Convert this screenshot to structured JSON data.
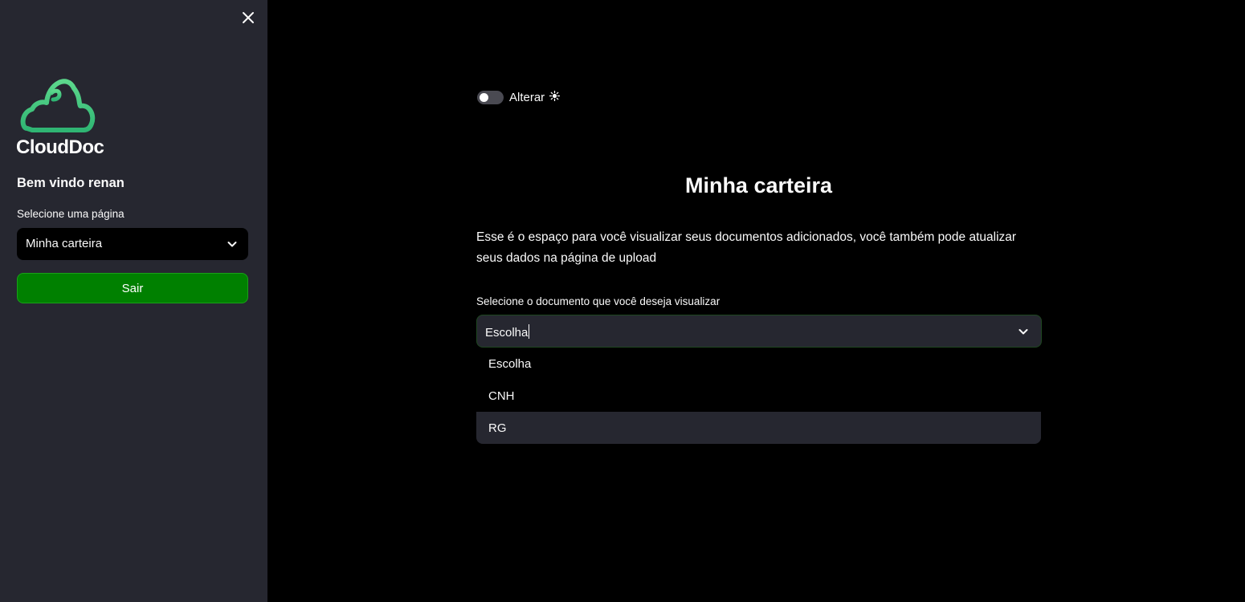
{
  "sidebar": {
    "logo_text": "CloudDoc",
    "welcome": "Bem vindo renan",
    "select_label": "Selecione uma página",
    "selected_page": "Minha carteira",
    "logout_label": "Sair",
    "logout_color": "#008000"
  },
  "main": {
    "toggle_label": "Alterar",
    "title": "Minha carteira",
    "description": "Esse é o espaço para você visualizar seus documentos adicionados, você também pode atualizar seus dados na página de upload",
    "doc_label": "Selecione o documento que você deseja visualizar",
    "doc_value": "Escolha",
    "options": [
      "Escolha",
      "CNH",
      "RG"
    ],
    "highlighted_option": "RG"
  },
  "colors": {
    "sidebar_bg": "#262730",
    "main_bg": "#000000",
    "logo_green": "#3fcf7a"
  }
}
